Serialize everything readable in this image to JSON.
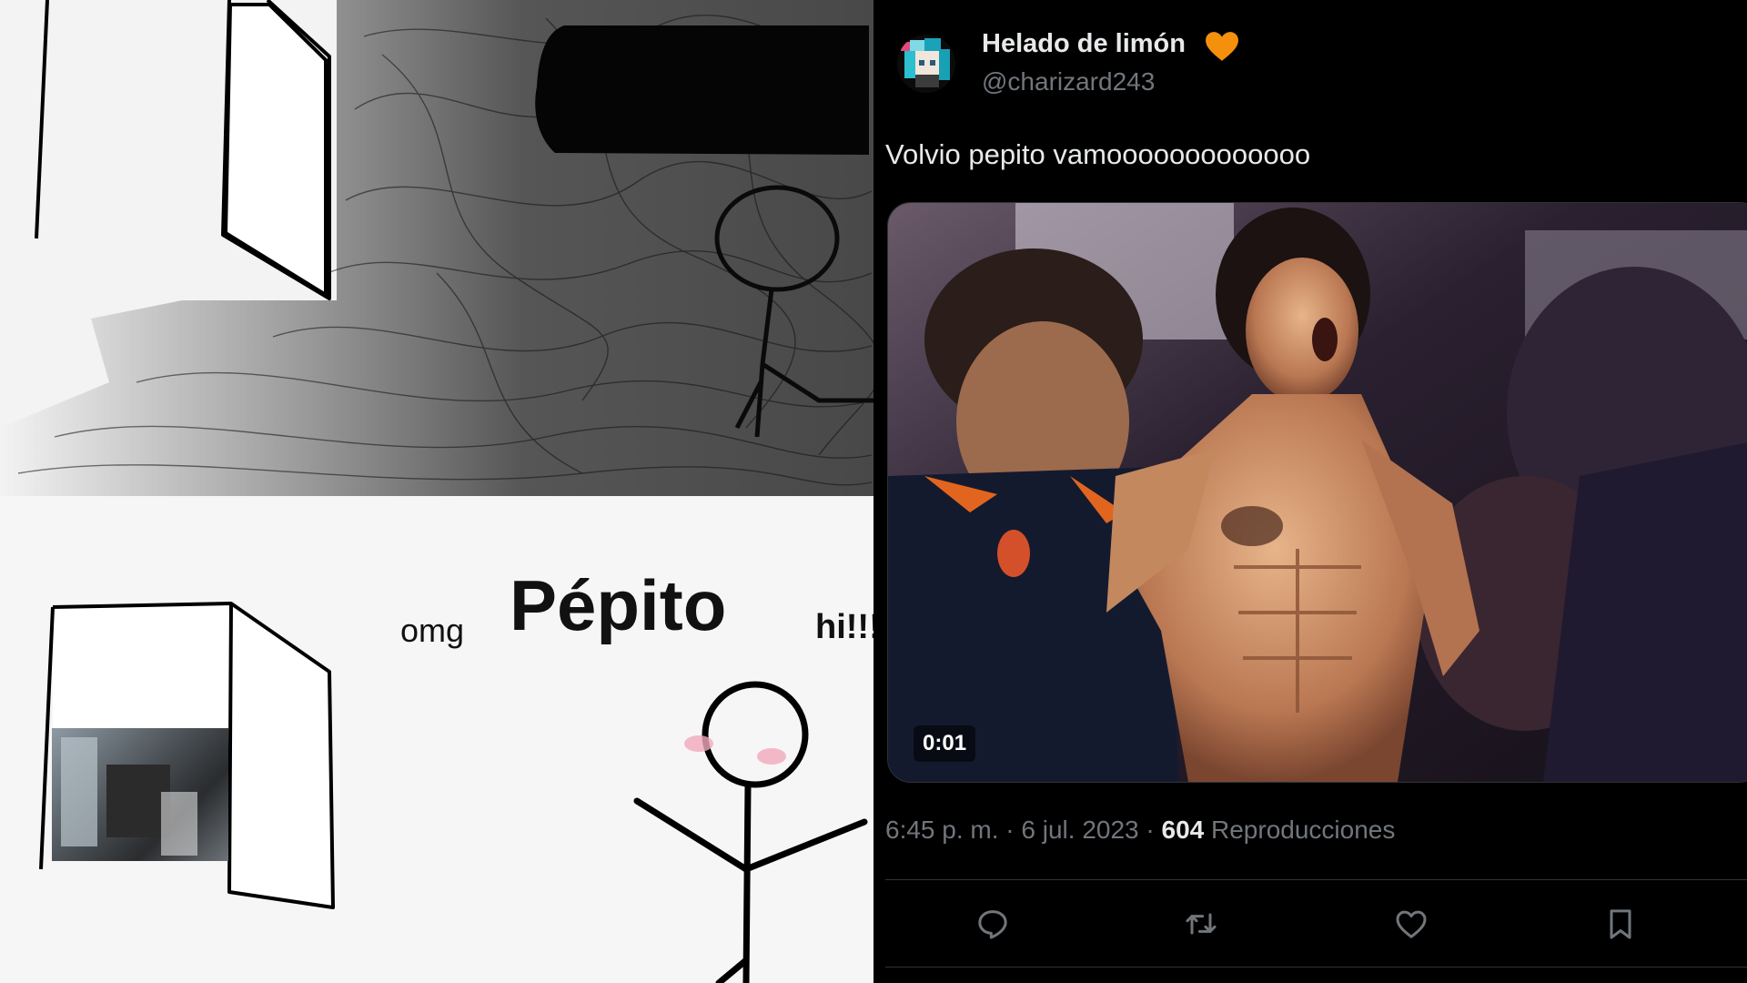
{
  "meme": {
    "omg": "omg",
    "title": "Pépito",
    "hi": "hi!!!"
  },
  "tweet": {
    "display_name": "Helado de limón",
    "name_emoji": "orange-heart-icon",
    "handle": "@charizard243",
    "text": "Volvio pepito vamooooooooooooo",
    "video_duration": "0:01",
    "timestamp": "6:45 p. m. · 6 jul. 2023 · ",
    "views_count": "604",
    "views_label": " Reproducciones",
    "actions": {
      "reply": "reply-icon",
      "retweet": "retweet-icon",
      "like": "like-icon",
      "bookmark": "bookmark-icon"
    },
    "colors": {
      "background": "#000000",
      "primary_text": "#e7e9ea",
      "secondary_text": "#71767b",
      "heart": "#f4900c"
    }
  }
}
